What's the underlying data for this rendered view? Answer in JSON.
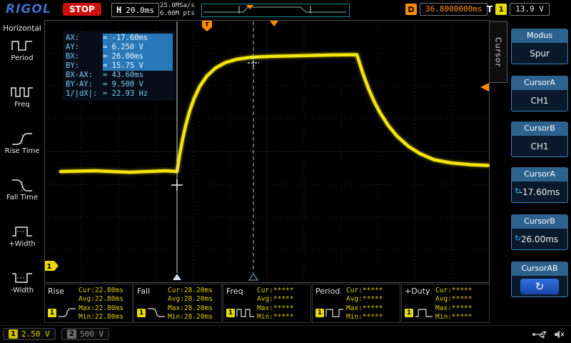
{
  "brand": "RIGOL",
  "topbar": {
    "run_state": "STOP",
    "h_label": "H",
    "h_scale": "20.0ms",
    "sample_rate": "25.0MSa/s",
    "mem_depth": "6.00M pts",
    "d_label": "D",
    "delay": "36.8000000ms",
    "t_label": "T",
    "trig_source": "1",
    "trig_level": "13.9 V"
  },
  "left_menu": {
    "title": "Horizontal",
    "items": [
      {
        "label": "Period"
      },
      {
        "label": "Freq"
      },
      {
        "label": "Rise Time"
      },
      {
        "label": "Fall Time"
      },
      {
        "label": "+Width"
      },
      {
        "label": "-Width"
      }
    ]
  },
  "cursor_tab": "Cursor",
  "right_menu": {
    "sections": [
      {
        "header": "Modus",
        "value": "Spur"
      },
      {
        "header": "CursorA",
        "value": "CH1"
      },
      {
        "header": "CursorB",
        "value": "CH1"
      },
      {
        "header": "CursorA",
        "value": "-17.60ms"
      },
      {
        "header": "CursorB",
        "value": "26.00ms"
      },
      {
        "header": "CursorAB",
        "value": ""
      }
    ]
  },
  "cursor_readout": {
    "rows": [
      {
        "label": "AX:",
        "value": "=  -17.60ms"
      },
      {
        "label": "AY:",
        "value": "=  6.250 V"
      },
      {
        "label": "BX:",
        "value": "=  26.00ms"
      },
      {
        "label": "BY:",
        "value": "=  15.75 V"
      },
      {
        "label": "BX-AX:",
        "value": "=  43.60ms"
      },
      {
        "label": "BY-AY:",
        "value": "=  9.500 V"
      },
      {
        "label": "1/|dX|:",
        "value": "=  22.93 Hz"
      }
    ]
  },
  "measurements": [
    {
      "name": "Rise",
      "channel": "1",
      "cur": "Cur:22.80ms",
      "avg": "Avg:22.80ms",
      "max": "Max:22.80ms",
      "min": "Min:22.80ms"
    },
    {
      "name": "Fall",
      "channel": "1",
      "cur": "Cur:28.20ms",
      "avg": "Avg:28.20ms",
      "max": "Max:28.20ms",
      "min": "Min:28.20ms"
    },
    {
      "name": "Freq",
      "channel": "1",
      "cur": "Cur:*****",
      "avg": "Avg:*****",
      "max": "Max:*****",
      "min": "Min:*****"
    },
    {
      "name": "Period",
      "channel": "1",
      "cur": "Cur:*****",
      "avg": "Avg:*****",
      "max": "Max:*****",
      "min": "Min:*****"
    },
    {
      "name": "+Duty",
      "channel": "1",
      "cur": "Cur:*****",
      "avg": "Avg:*****",
      "max": "Max:*****",
      "min": "Min:*****"
    }
  ],
  "channels": [
    {
      "num": "1",
      "scale": "2.50 V"
    },
    {
      "num": "2",
      "scale": "500 V"
    }
  ],
  "ground_marker": "1",
  "colors": {
    "ch1_yellow": "#f2e50c",
    "ch2_gray": "#8a8a8a",
    "cursor_highlight": "#2878b8",
    "readout_text": "#7ec8e8",
    "trigger_orange": "#ff8c00",
    "menu_header_blue": "#2e628e"
  }
}
